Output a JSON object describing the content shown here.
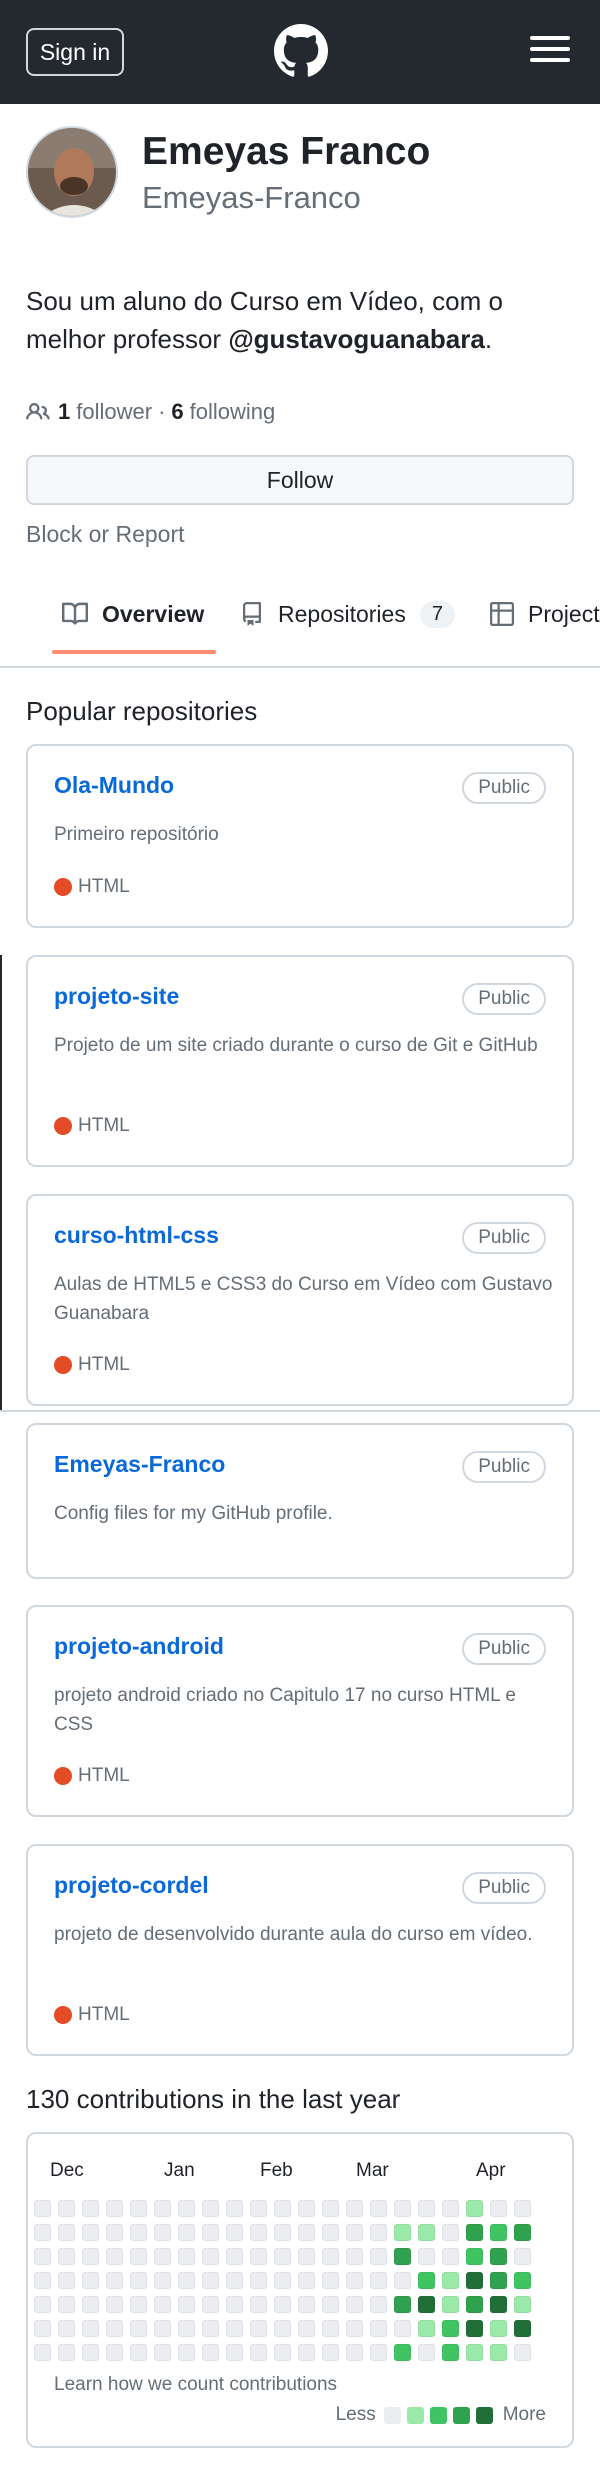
{
  "header": {
    "signin_label": "Sign in"
  },
  "profile": {
    "name": "Emeyas Franco",
    "login": "Emeyas-Franco",
    "bio_text": "Sou um aluno do Curso em Vídeo, com o melhor professor ",
    "bio_mention": "@gustavoguanabara",
    "bio_end": ".",
    "followers_count": "1",
    "followers_label": "follower",
    "separator": "·",
    "following_count": "6",
    "following_label": "following",
    "follow_label": "Follow",
    "block_label": "Block or Report"
  },
  "tabs": {
    "overview": "Overview",
    "repositories": "Repositories",
    "repositories_count": "7",
    "projects": "Projects"
  },
  "popular": {
    "title": "Popular repositories",
    "repos": [
      {
        "name": "Ola-Mundo",
        "visibility": "Public",
        "description": "Primeiro repositório",
        "language": "HTML"
      },
      {
        "name": "projeto-site",
        "visibility": "Public",
        "description": "Projeto de um site criado durante o curso de Git e GitHub",
        "language": "HTML"
      },
      {
        "name": "curso-html-css",
        "visibility": "Public",
        "description": "Aulas de HTML5 e CSS3 do Curso em Vídeo com Gustavo Guanabara",
        "language": "HTML"
      },
      {
        "name": "Emeyas-Franco",
        "visibility": "Public",
        "description": "Config files for my GitHub profile.",
        "language": ""
      },
      {
        "name": "projeto-android",
        "visibility": "Public",
        "description": "projeto android criado no Capitulo 17 no curso HTML e CSS",
        "language": "HTML"
      },
      {
        "name": "projeto-cordel",
        "visibility": "Public",
        "description": "projeto de desenvolvido durante aula do curso em vídeo.",
        "language": "HTML"
      }
    ]
  },
  "contributions": {
    "title": "130 contributions in the last year",
    "months": [
      "Dec",
      "Jan",
      "Feb",
      "Mar",
      "Apr"
    ],
    "learn_label": "Learn how we count contributions",
    "less_label": "Less",
    "more_label": "More",
    "levels_colors": [
      "#ebedf0",
      "#9be9a8",
      "#40c463",
      "#30a14e",
      "#216e39"
    ],
    "weeks": [
      [
        0,
        0,
        0,
        0,
        0,
        0,
        0
      ],
      [
        0,
        0,
        0,
        0,
        0,
        0,
        0
      ],
      [
        0,
        0,
        0,
        0,
        0,
        0,
        0
      ],
      [
        0,
        0,
        0,
        0,
        0,
        0,
        0
      ],
      [
        0,
        0,
        0,
        0,
        0,
        0,
        0
      ],
      [
        0,
        0,
        0,
        0,
        0,
        0,
        0
      ],
      [
        0,
        0,
        0,
        0,
        0,
        0,
        0
      ],
      [
        0,
        0,
        0,
        0,
        0,
        0,
        0
      ],
      [
        0,
        0,
        0,
        0,
        0,
        0,
        0
      ],
      [
        0,
        0,
        0,
        0,
        0,
        0,
        0
      ],
      [
        0,
        0,
        0,
        0,
        0,
        0,
        0
      ],
      [
        0,
        0,
        0,
        0,
        0,
        0,
        0
      ],
      [
        0,
        0,
        0,
        0,
        0,
        0,
        0
      ],
      [
        0,
        0,
        0,
        0,
        0,
        0,
        0
      ],
      [
        0,
        0,
        0,
        0,
        0,
        0,
        0
      ],
      [
        0,
        1,
        3,
        0,
        3,
        0,
        2
      ],
      [
        0,
        1,
        0,
        2,
        4,
        1,
        0
      ],
      [
        0,
        0,
        0,
        1,
        1,
        2,
        2
      ],
      [
        1,
        3,
        2,
        4,
        3,
        4,
        1
      ],
      [
        0,
        2,
        3,
        3,
        4,
        1,
        1
      ],
      [
        0,
        3,
        0,
        2,
        1,
        4,
        0
      ]
    ],
    "language_color": "#e34c26",
    "brand_link_color": "#0969da",
    "tab_underline_color": "#fd8c73"
  }
}
